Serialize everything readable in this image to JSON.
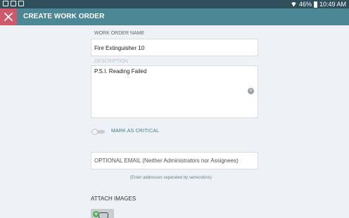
{
  "status_bar": {
    "battery": "46%",
    "time": "10:49 AM",
    "icons": [
      "photo-icon",
      "image-icon",
      "usb-icon",
      "wifi-icon",
      "battery-icon"
    ]
  },
  "app_bar": {
    "title": "CREATE WORK ORDER",
    "close_icon": "close-icon",
    "accent": "#4b8795",
    "close_bg": "#cc5a6b"
  },
  "form": {
    "name_label": "WORK ORDER NAME",
    "name_value": "Fire Extinguisher 10",
    "description_placeholder": "DESCRIPTION",
    "description_value": "P.S.I. Reading Failed",
    "critical_label": "MARK AS CRITICAL",
    "critical_on": false,
    "email_placeholder": "OPTIONAL EMAIL (Neither Administrators nor Assignees)",
    "email_hint": "(Enter addresses separated by semicolons)",
    "attach_label": "ATTACH IMAGES"
  }
}
